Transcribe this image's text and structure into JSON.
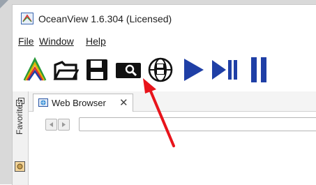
{
  "window": {
    "title": "OceanView 1.6.304 (Licensed)"
  },
  "menu": {
    "file": "File",
    "window": "Window",
    "help": "Help"
  },
  "toolbar": {
    "buttons": [
      {
        "icon": "spectrum-peak-icon"
      },
      {
        "icon": "open-folder-icon"
      },
      {
        "icon": "save-icon"
      },
      {
        "icon": "capture-reference-icon"
      },
      {
        "icon": "network-save-icon"
      },
      {
        "icon": "play-icon"
      },
      {
        "icon": "play-pause-icon"
      },
      {
        "icon": "pause-icon"
      }
    ]
  },
  "sidebar": {
    "favorites_label": "Favorites"
  },
  "tabs": [
    {
      "label": "Web Browser",
      "close": "✕"
    }
  ],
  "browser": {
    "url_value": ""
  },
  "colors": {
    "accent_blue": "#1f3fa6",
    "arrow_red": "#e8141b"
  }
}
